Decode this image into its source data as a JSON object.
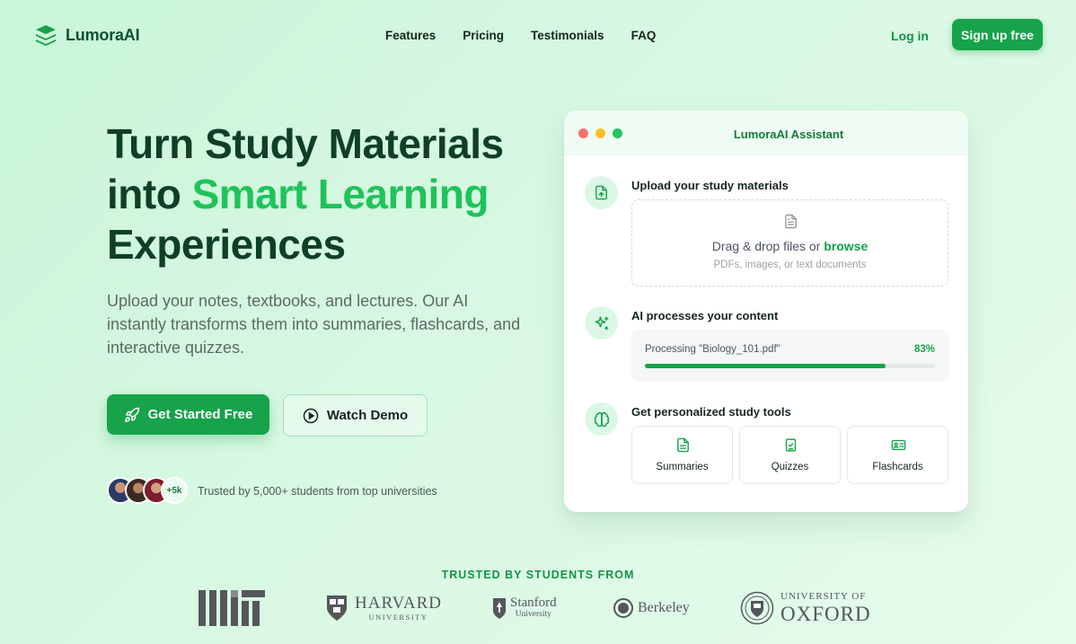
{
  "brand": {
    "name": "LumoraAI"
  },
  "nav": {
    "links": [
      "Features",
      "Pricing",
      "Testimonials",
      "FAQ"
    ],
    "login": "Log in",
    "signup": "Sign up free"
  },
  "hero": {
    "title_line1": "Turn Study Materials",
    "title_line2_prefix": "into ",
    "title_line2_accent": "Smart Learning",
    "title_line3": "Experiences",
    "subtitle": "Upload your notes, textbooks, and lectures. Our AI instantly transforms them into summaries, flashcards, and interactive quizzes.",
    "primary_cta": "Get Started Free",
    "secondary_cta": "Watch Demo",
    "avatar_more": "+5k",
    "trusted_text": "Trusted by 5,000+ students from top universities"
  },
  "assistant": {
    "title": "LumoraAI Assistant",
    "step1_label": "Upload your study materials",
    "drop_text": "Drag & drop files or ",
    "drop_browse": "browse",
    "drop_sub": "PDFs, images, or text documents",
    "step2_label": "AI processes your content",
    "processing_text": "Processing \"Biology_101.pdf\"",
    "processing_percent_label": "83%",
    "processing_progress": 0.83,
    "step3_label": "Get personalized study tools",
    "tools": [
      {
        "label": "Summaries",
        "icon": "document-icon"
      },
      {
        "label": "Quizzes",
        "icon": "checklist-icon"
      },
      {
        "label": "Flashcards",
        "icon": "card-icon"
      }
    ]
  },
  "trusted": {
    "heading": "TRUSTED BY STUDENTS FROM",
    "universities": {
      "harvard_main": "HARVARD",
      "harvard_sub": "UNIVERSITY",
      "stanford_main": "Stanford",
      "stanford_sub": "University",
      "berkeley": "Berkeley",
      "oxford_top": "UNIVERSITY OF",
      "oxford_main": "OXFORD"
    }
  },
  "colors": {
    "accent": "#16a34a",
    "accent_light": "#1fc35a",
    "title": "#0f4024"
  }
}
